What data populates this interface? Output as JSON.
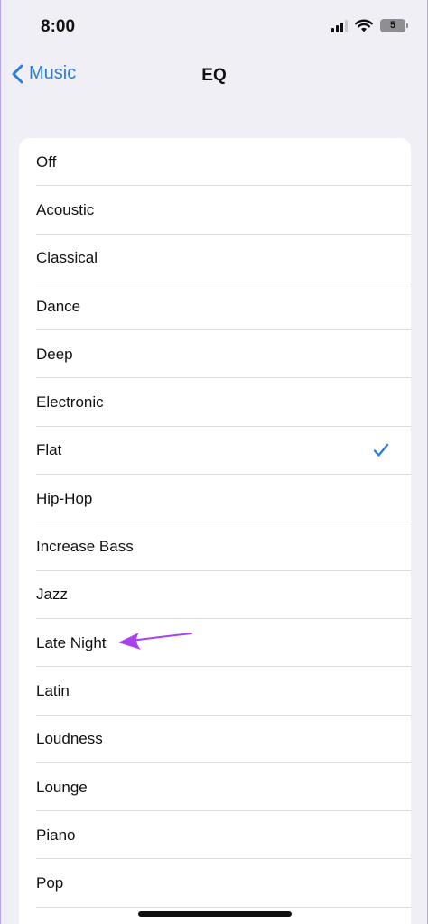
{
  "status_bar": {
    "time": "8:00",
    "battery_level": "5",
    "signal_icon": "cellular-signal-icon",
    "wifi_icon": "wifi-icon"
  },
  "nav": {
    "back_label": "Music",
    "title": "EQ"
  },
  "eq_options": [
    {
      "label": "Off"
    },
    {
      "label": "Acoustic"
    },
    {
      "label": "Classical"
    },
    {
      "label": "Dance"
    },
    {
      "label": "Deep"
    },
    {
      "label": "Electronic"
    },
    {
      "label": "Flat",
      "selected": true
    },
    {
      "label": "Hip-Hop"
    },
    {
      "label": "Increase Bass"
    },
    {
      "label": "Jazz"
    },
    {
      "label": "Late Night",
      "annotated": true
    },
    {
      "label": "Latin"
    },
    {
      "label": "Loudness"
    },
    {
      "label": "Lounge"
    },
    {
      "label": "Piano"
    },
    {
      "label": "Pop"
    }
  ],
  "colors": {
    "accent": "#2f7bd9",
    "annotation": "#a742ee",
    "background": "#f0eff5"
  }
}
